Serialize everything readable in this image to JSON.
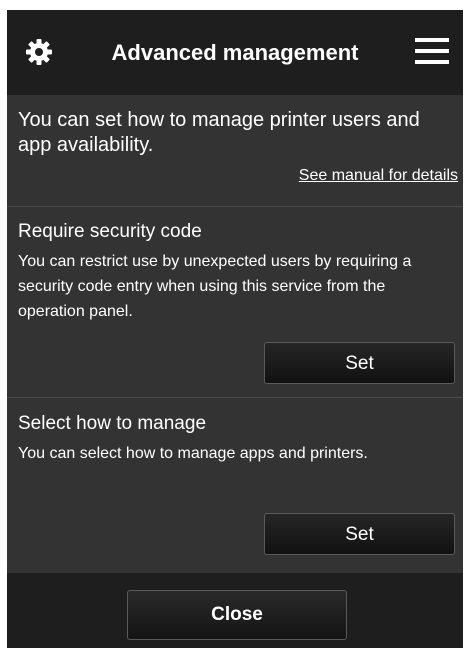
{
  "header": {
    "title": "Advanced management",
    "left_icon": "gear-icon",
    "right_icon": "hamburger-menu-icon"
  },
  "intro": {
    "text": "You can set how to manage printer users and app availability.",
    "manual_link": "See manual for details"
  },
  "sections": [
    {
      "title": "Require security code",
      "description": "You can restrict use by unexpected users by requiring a security code entry when using this service from the operation panel.",
      "button_label": "Set"
    },
    {
      "title": "Select how to manage",
      "description": "You can select how to manage apps and printers.",
      "button_label": "Set"
    }
  ],
  "footer": {
    "close_label": "Close"
  },
  "colors": {
    "header_bg": "#1e1e1e",
    "content_bg": "#333333",
    "text": "#ffffff"
  }
}
